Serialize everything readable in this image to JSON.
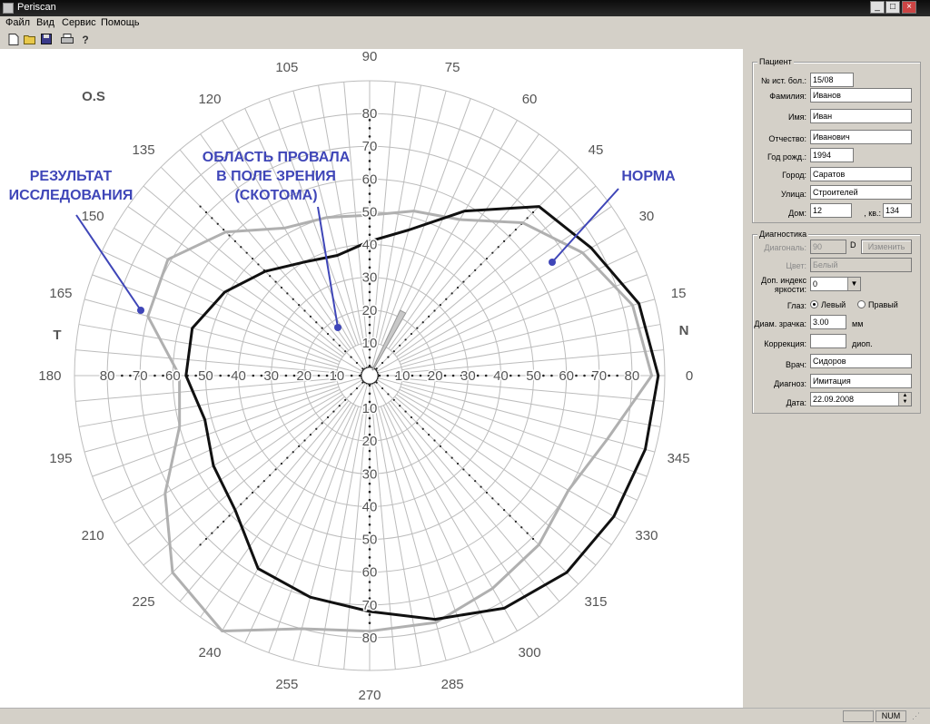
{
  "window": {
    "title": "Periscan",
    "min": "_",
    "max": "□",
    "close": "×"
  },
  "menu": [
    "Файл",
    "Вид",
    "Сервис",
    "Помощь"
  ],
  "toolbar": {
    "icons": [
      "new-icon",
      "open-icon",
      "save-icon",
      "print-icon",
      "help-icon"
    ]
  },
  "chart": {
    "eye_label": "O.S",
    "side_left": "T",
    "side_right": "N",
    "angle_labels": [
      "0",
      "15",
      "30",
      "45",
      "60",
      "75",
      "90",
      "105",
      "120",
      "135",
      "150",
      "165",
      "180",
      "195",
      "210",
      "225",
      "240",
      "255",
      "270",
      "285",
      "300",
      "315",
      "330",
      "345"
    ],
    "ring_labels": [
      "10",
      "20",
      "30",
      "40",
      "50",
      "60",
      "70",
      "80"
    ],
    "annotations": {
      "result": [
        "РЕЗУЛЬТАТ",
        "ИССЛЕДОВАНИЯ"
      ],
      "scotoma": [
        "ОБЛАСТЬ ПРОВАЛА",
        "В ПОЛЕ ЗРЕНИЯ",
        "(СКОТОМА)"
      ],
      "norm": "НОРМА"
    },
    "colors": {
      "result": "#111111",
      "norm": "#b0b0b0",
      "annotation": "#3f46b8",
      "grid": "#bcbcbc"
    }
  },
  "chart_data": {
    "type": "polar",
    "radial_unit": "degrees",
    "r_max": 90,
    "angle_ticks": [
      0,
      15,
      30,
      45,
      60,
      75,
      90,
      105,
      120,
      135,
      150,
      165,
      180,
      195,
      210,
      225,
      240,
      255,
      270,
      285,
      300,
      315,
      330,
      345
    ],
    "series": [
      {
        "name": "РЕЗУЛЬТАТ ИССЛЕДОВАНИЯ",
        "points": [
          [
            0,
            88
          ],
          [
            15,
            85
          ],
          [
            30,
            78
          ],
          [
            45,
            73
          ],
          [
            60,
            58
          ],
          [
            75,
            46
          ],
          [
            90,
            41
          ],
          [
            105,
            38
          ],
          [
            120,
            40
          ],
          [
            135,
            45
          ],
          [
            150,
            51
          ],
          [
            165,
            56
          ],
          [
            180,
            56
          ],
          [
            195,
            52
          ],
          [
            210,
            55
          ],
          [
            225,
            58
          ],
          [
            240,
            68
          ],
          [
            255,
            70
          ],
          [
            270,
            72
          ],
          [
            285,
            77
          ],
          [
            300,
            82
          ],
          [
            315,
            85
          ],
          [
            330,
            86
          ],
          [
            345,
            87
          ]
        ]
      },
      {
        "name": "НОРМА",
        "points": [
          [
            0,
            86
          ],
          [
            15,
            83
          ],
          [
            30,
            75
          ],
          [
            45,
            66
          ],
          [
            60,
            55
          ],
          [
            75,
            52
          ],
          [
            90,
            49
          ],
          [
            105,
            50
          ],
          [
            120,
            52
          ],
          [
            135,
            62
          ],
          [
            150,
            71
          ],
          [
            165,
            70
          ],
          [
            180,
            58
          ],
          [
            195,
            60
          ],
          [
            210,
            72
          ],
          [
            225,
            85
          ],
          [
            240,
            90
          ],
          [
            255,
            80
          ],
          [
            270,
            78
          ],
          [
            285,
            78
          ],
          [
            300,
            75
          ],
          [
            315,
            73
          ],
          [
            330,
            70
          ],
          [
            345,
            75
          ]
        ]
      },
      {
        "name": "ОБЛАСТЬ ПРОВАЛА В ПОЛЕ ЗРЕНИЯ (СКОТОМА)",
        "points": [
          [
            58,
            2
          ],
          [
            60,
            22
          ],
          [
            65,
            22
          ],
          [
            67,
            2
          ]
        ]
      }
    ]
  },
  "patient": {
    "group_title": "Пациент",
    "fields": [
      {
        "label": "№ ист. бол.:",
        "value": "15/08"
      },
      {
        "label": "Фамилия:",
        "value": "Иванов"
      },
      {
        "label": "Имя:",
        "value": "Иван"
      },
      {
        "label": "Отчество:",
        "value": "Иванович"
      },
      {
        "label": "Год рожд.:",
        "value": "1994"
      },
      {
        "label": "Город:",
        "value": "Саратов"
      },
      {
        "label": "Улица:",
        "value": "Строителей"
      }
    ],
    "house_label": "Дом:",
    "house_value": "12",
    "apt_label": ", кв.:",
    "apt_value": "134"
  },
  "diagnostics": {
    "group_title": "Диагностика",
    "diagonal_label": "Диагональ:",
    "diagonal_value": "90",
    "diagonal_unit": "D",
    "change_button": "Изменить",
    "color_label": "Цвет:",
    "color_value": "Белый",
    "brightness_label_1": "Доп. индекс",
    "brightness_label_2": "яркости:",
    "brightness_value": "0",
    "eye_label": "Глаз:",
    "eye_left": "Левый",
    "eye_right": "Правый",
    "eye_selected": "left",
    "pupil_label": "Диам. зрачка:",
    "pupil_value": "3.00",
    "pupil_unit": "мм",
    "correction_label": "Коррекция:",
    "correction_value": "",
    "correction_unit": "диоп.",
    "doctor_label": "Врач:",
    "doctor_value": "Сидоров",
    "diagnosis_label": "Диагноз:",
    "diagnosis_value": "Имитация",
    "date_label": "Дата:",
    "date_value": "22.09.2008"
  },
  "status": {
    "num": "NUM"
  }
}
